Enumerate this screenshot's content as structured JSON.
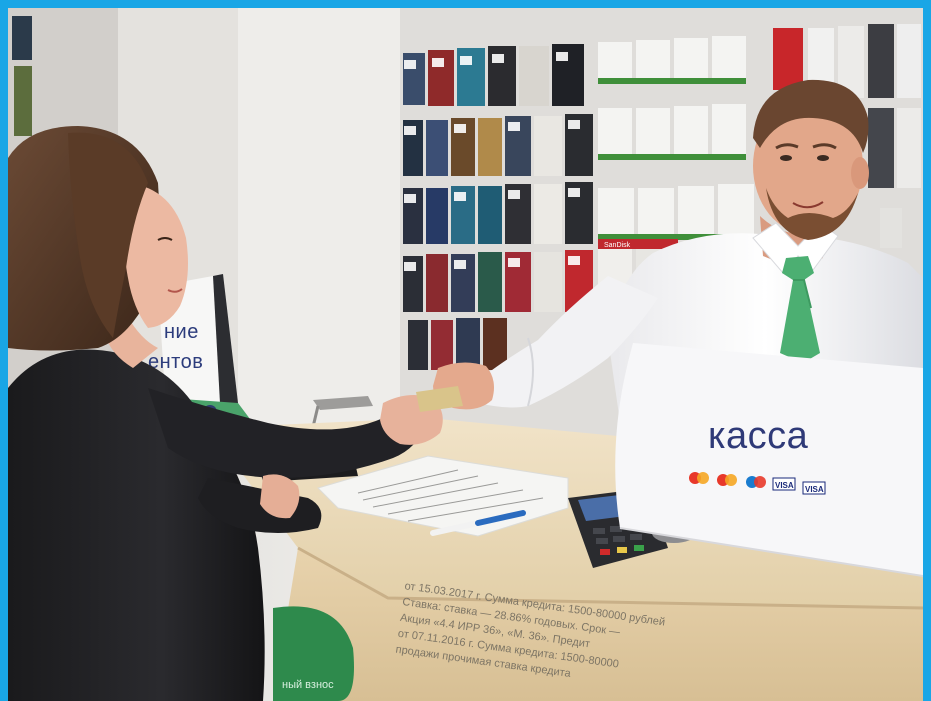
{
  "image": {
    "frame_color": "#19a6e6",
    "dimensions_note": ""
  },
  "signs": {
    "cashier": "касса",
    "left_fragment_line1": "ние",
    "left_fragment_line2": "ентов",
    "counter_green_fragment": "ный взнос"
  },
  "payment_logos": [
    "Maestro",
    "MasterCard",
    "Maestro",
    "VISA",
    "VISA"
  ],
  "counter_fine_print": [
    "от 15.03.2017 г. Сумма кредита: 1500-80000 рублей",
    "Ставка: ставка — 28.86% годовых. Срок —",
    "Акция «4.4 ИРР 36», «М. 36». Предит",
    "от 07.11.2016 г. Сумма кредита: 1500-80000",
    "продажи прочимая ставка кредита"
  ],
  "shelf_tag_text": "SanDisk"
}
